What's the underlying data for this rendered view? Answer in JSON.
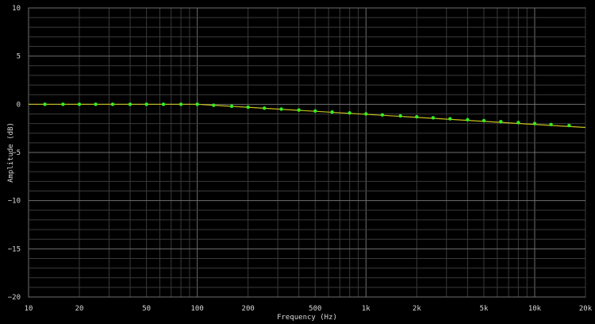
{
  "chart_data": {
    "type": "line",
    "title": "",
    "xlabel": "Frequency (Hz)",
    "ylabel": "Amplitude (dB)",
    "x_scale": "log",
    "xlim": [
      10,
      20000
    ],
    "ylim": [
      -20,
      10
    ],
    "grid": true,
    "legend": "none",
    "x_ticks": [
      {
        "value": 10,
        "label": "10"
      },
      {
        "value": 20,
        "label": "20"
      },
      {
        "value": 50,
        "label": "50"
      },
      {
        "value": 100,
        "label": "100"
      },
      {
        "value": 200,
        "label": "200"
      },
      {
        "value": 500,
        "label": "500"
      },
      {
        "value": 1000,
        "label": "1k"
      },
      {
        "value": 2000,
        "label": "2k"
      },
      {
        "value": 5000,
        "label": "5k"
      },
      {
        "value": 10000,
        "label": "10k"
      },
      {
        "value": 20000,
        "label": "20k"
      }
    ],
    "y_ticks": [
      {
        "value": 10,
        "label": "10"
      },
      {
        "value": 5,
        "label": "5"
      },
      {
        "value": 0,
        "label": "0"
      },
      {
        "value": -5,
        "label": "−5"
      },
      {
        "value": -10,
        "label": "−10"
      },
      {
        "value": -15,
        "label": "−15"
      },
      {
        "value": -20,
        "label": "−20"
      }
    ],
    "series": [
      {
        "color": "#c8c020",
        "kind": "line",
        "x": [
          10,
          100,
          20000
        ],
        "y": [
          0,
          0,
          -2.4
        ]
      },
      {
        "color": "#33ee22",
        "kind": "markers",
        "x": [
          12.5,
          16,
          20,
          25,
          31.5,
          40,
          50,
          63,
          80,
          100,
          125,
          160,
          200,
          250,
          315,
          400,
          500,
          630,
          800,
          1000,
          1250,
          1600,
          2000,
          2500,
          3150,
          4000,
          5000,
          6300,
          8000,
          10000,
          12500,
          16000
        ],
        "y": [
          0,
          0,
          0,
          0,
          0,
          0,
          0,
          0,
          0,
          0,
          -0.1,
          -0.2,
          -0.3,
          -0.4,
          -0.5,
          -0.6,
          -0.7,
          -0.8,
          -0.9,
          -1.0,
          -1.1,
          -1.2,
          -1.3,
          -1.4,
          -1.5,
          -1.6,
          -1.7,
          -1.8,
          -1.9,
          -2.0,
          -2.1,
          -2.2
        ]
      }
    ]
  },
  "colors": {
    "background": "#000000",
    "grid_minor": "#3a3a3a",
    "grid_major": "#6e6e6e",
    "line": "#c8c020",
    "marker": "#33ee22",
    "text": "#d8d8d8"
  }
}
